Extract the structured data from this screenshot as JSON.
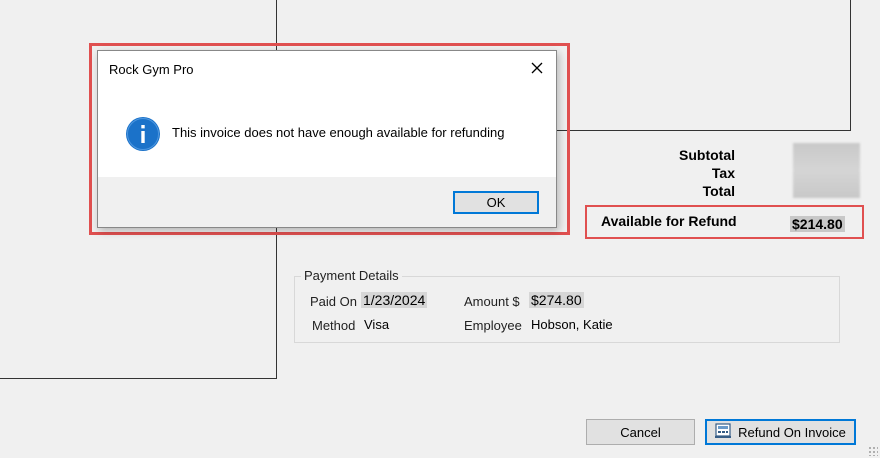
{
  "dialog": {
    "title": "Rock Gym Pro",
    "message": "This invoice does not have enough available for refunding",
    "ok_label": "OK",
    "icon": "info-icon"
  },
  "totals": {
    "subtotal_label": "Subtotal",
    "tax_label": "Tax",
    "total_label": "Total",
    "available_label": "Available for Refund",
    "available_value": "$214.80"
  },
  "payment_details": {
    "title": "Payment Details",
    "paid_on_label": "Paid On",
    "paid_on_value": "1/23/2024",
    "method_label": "Method",
    "method_value": "Visa",
    "amount_label": "Amount $",
    "amount_value": "$274.80",
    "employee_label": "Employee",
    "employee_value": "Hobson, Katie"
  },
  "actions": {
    "cancel_label": "Cancel",
    "refund_label": "Refund On Invoice"
  },
  "colors": {
    "highlight": "#e05050",
    "accent": "#0078d7",
    "info_icon": "#1b72c9"
  }
}
